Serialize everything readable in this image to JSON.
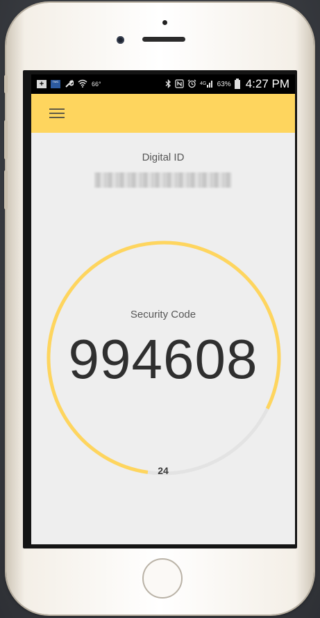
{
  "status_bar": {
    "left_icons": [
      "plus-box-icon",
      "weather-channel-icon",
      "wrench-icon",
      "wifi-icon"
    ],
    "temperature": "66°",
    "right_icons": [
      "bluetooth-icon",
      "nfc-icon",
      "alarm-icon",
      "signal-4g-icon"
    ],
    "battery_percent": "63%",
    "time": "4:27 PM"
  },
  "app_bar": {
    "menu_icon": "hamburger-menu-icon",
    "accent_color": "#fed55e"
  },
  "digital_id": {
    "label": "Digital ID"
  },
  "security": {
    "caption": "Security Code",
    "code": "994608",
    "countdown": "24",
    "timer_fraction_remaining": 0.8,
    "ring_color": "#fed55e",
    "ring_track_color": "#e3e3e3"
  }
}
